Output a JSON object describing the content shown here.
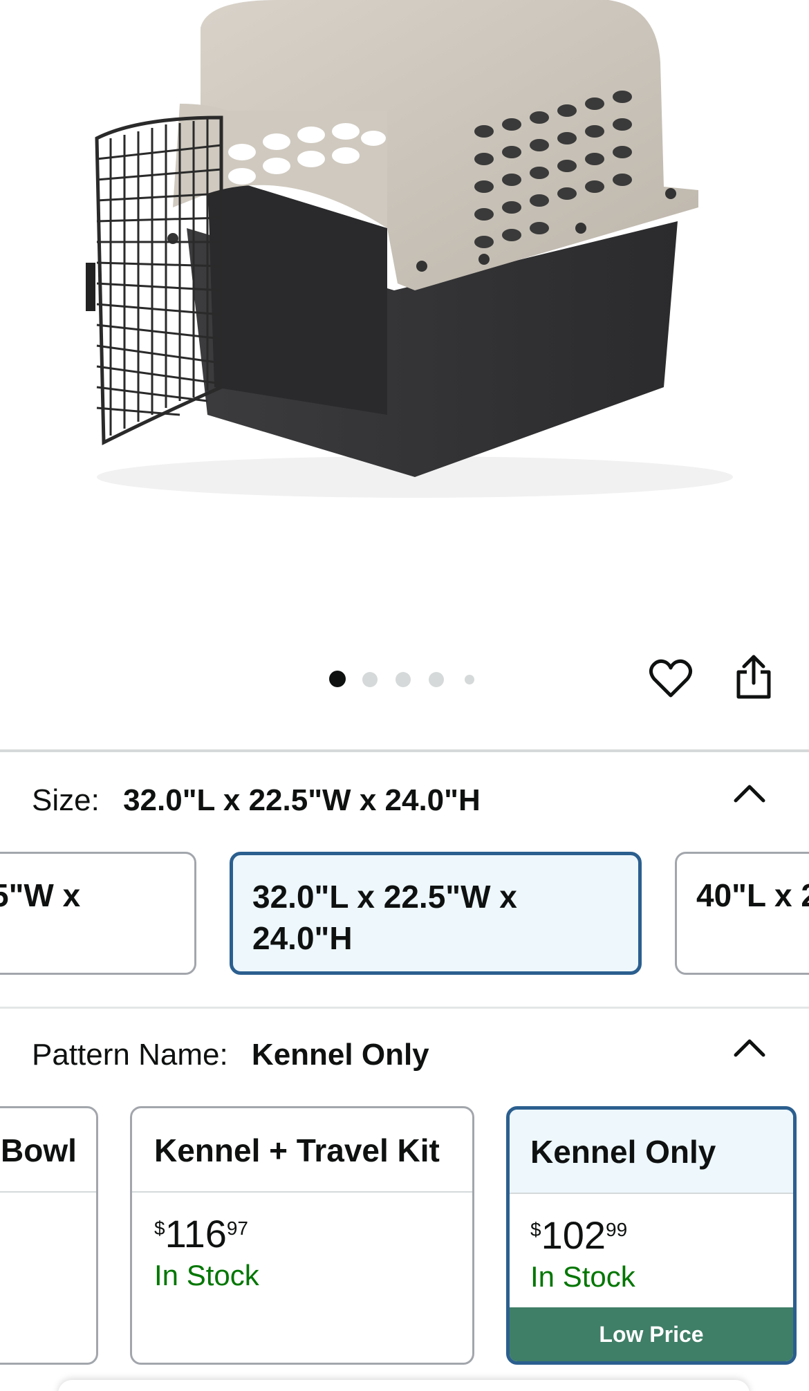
{
  "gallery": {
    "image_alt": "Pet travel kennel with open wire door",
    "dots_total": 5,
    "dots_active_index": 0
  },
  "actions": {
    "wishlist_icon": "heart-icon",
    "share_icon": "share-icon"
  },
  "size": {
    "label": "Size:",
    "selected_value": "32.0\"L x 22.5\"W x 24.0\"H",
    "options": [
      {
        "label": "5\"W x"
      },
      {
        "label": "32.0\"L x 22.5\"W x 24.0\"H"
      },
      {
        "label": "40\"L x 2"
      }
    ]
  },
  "pattern": {
    "label": "Pattern Name:",
    "selected_value": "Kennel Only",
    "options": [
      {
        "title": "Bowl"
      },
      {
        "title": "Kennel + Travel Kit",
        "price_symbol": "$",
        "price_whole": "116",
        "price_fraction": "97",
        "stock": "In Stock"
      },
      {
        "title": "Kennel Only",
        "price_symbol": "$",
        "price_whole": "102",
        "price_fraction": "99",
        "stock": "In Stock",
        "badge": "Low Price"
      }
    ]
  },
  "colors": {
    "selected_border": "#2b5f8f",
    "selected_fill": "#edf7fc",
    "in_stock": "#007600",
    "badge": "#3f7e67"
  }
}
